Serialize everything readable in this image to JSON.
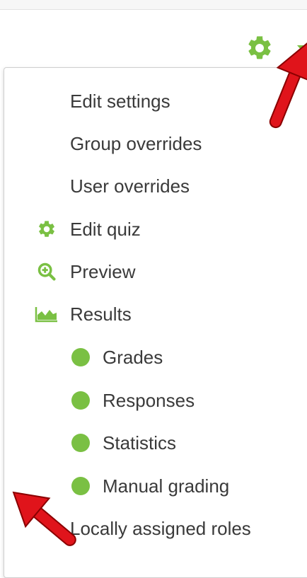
{
  "menu": {
    "items": [
      {
        "label": "Edit settings",
        "icon": "none"
      },
      {
        "label": "Group overrides",
        "icon": "none"
      },
      {
        "label": "User overrides",
        "icon": "none"
      },
      {
        "label": "Edit quiz",
        "icon": "gear-icon"
      },
      {
        "label": "Preview",
        "icon": "zoom-in-icon"
      },
      {
        "label": "Results",
        "icon": "area-chart-icon"
      },
      {
        "label": "Grades",
        "icon": "dot-icon"
      },
      {
        "label": "Responses",
        "icon": "dot-icon"
      },
      {
        "label": "Statistics",
        "icon": "dot-icon"
      },
      {
        "label": "Manual grading",
        "icon": "dot-icon"
      },
      {
        "label": "Locally assigned roles",
        "icon": "none"
      }
    ]
  },
  "colors": {
    "accent": "#7ac043",
    "text": "#3a3a3a",
    "annotation_arrow": "#e0141b"
  }
}
